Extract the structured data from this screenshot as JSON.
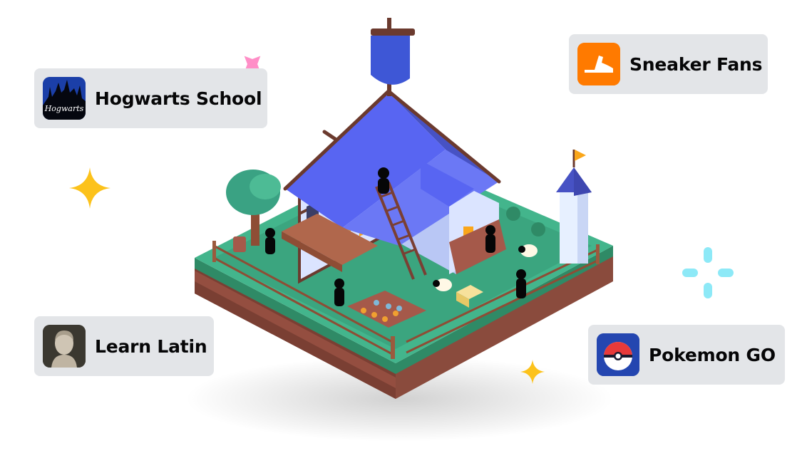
{
  "servers": [
    {
      "name": "Hogwarts School",
      "icon": "hogwarts-castle-icon",
      "icon_text": "Hogwarts"
    },
    {
      "name": "Sneaker Fans",
      "icon": "sneaker-icon"
    },
    {
      "name": "Learn Latin",
      "icon": "roman-bust-icon"
    },
    {
      "name": "Pokemon GO",
      "icon": "pokeball-icon"
    }
  ],
  "colors": {
    "card_bg": "#e3e5e8",
    "roof": "#5865f2",
    "grass": "#3ba55c",
    "sparkle_yellow": "#fcc21b",
    "sparkle_pink": "#ff8ec7",
    "sparkle_cyan": "#8de9f7",
    "sneaker_bg": "#ff7a00"
  }
}
